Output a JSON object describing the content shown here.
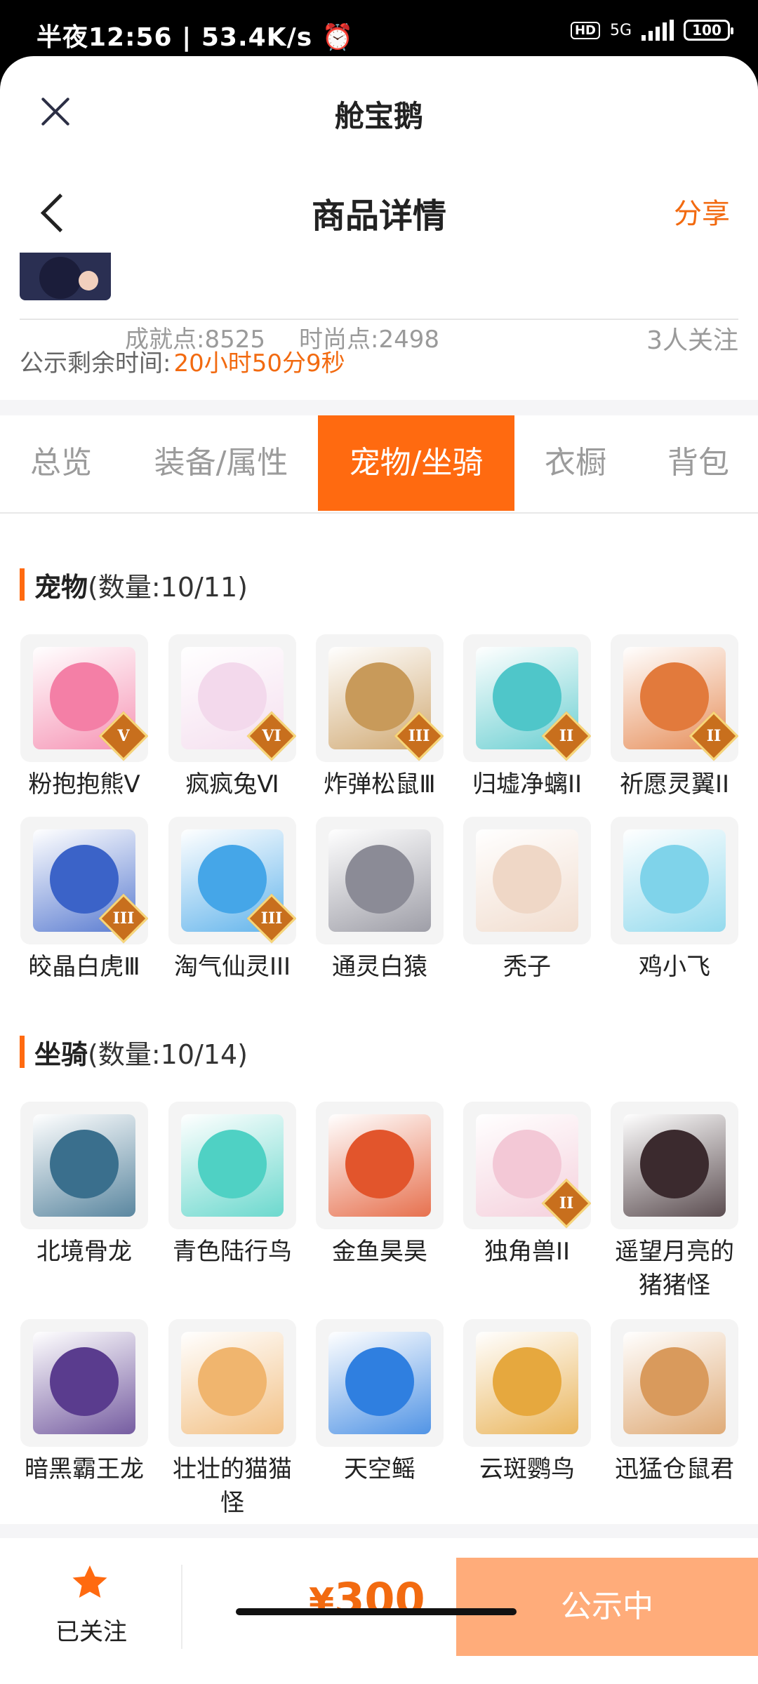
{
  "status_bar": {
    "time": "半夜12:56",
    "separator": "|",
    "speed": "53.4K/s",
    "hd": "HD",
    "network": "5G",
    "battery": "100"
  },
  "mini_app": {
    "title": "舱宝鹅"
  },
  "nav": {
    "title": "商品详情",
    "share": "分享"
  },
  "profile": {
    "achievement": "成就点:8525",
    "fashion": "时尚点:2498",
    "followers": "3人关注"
  },
  "publicity": {
    "label": "公示剩余时间:",
    "remaining": "20小时50分9秒"
  },
  "tabs": [
    {
      "label": "总览"
    },
    {
      "label": "装备/属性"
    },
    {
      "label": "宠物/坐骑",
      "active": true
    },
    {
      "label": "衣橱"
    },
    {
      "label": "背包"
    }
  ],
  "pets": {
    "title": "宠物",
    "count": "(数量:10/11)",
    "items": [
      {
        "name": "粉抱抱熊Ⅴ",
        "badge": "V",
        "color": "#f47fa6"
      },
      {
        "name": "疯疯兔Ⅵ",
        "badge": "VI",
        "color": "#f3d9ec"
      },
      {
        "name": "炸弹松鼠Ⅲ",
        "badge": "III",
        "color": "#c89a5a"
      },
      {
        "name": "归墟净螭II",
        "badge": "II",
        "color": "#4fc6c9"
      },
      {
        "name": "祈愿灵翼II",
        "badge": "II",
        "color": "#e27a3c"
      },
      {
        "name": "皎晶白虎Ⅲ",
        "badge": "III",
        "color": "#3b63c8"
      },
      {
        "name": "淘气仙灵III",
        "badge": "III",
        "color": "#45a6e8"
      },
      {
        "name": "通灵白猿",
        "badge": "",
        "color": "#8b8b96"
      },
      {
        "name": "秃子",
        "badge": "",
        "color": "#efd7c6"
      },
      {
        "name": "鸡小飞",
        "badge": "",
        "color": "#7fd3ea"
      }
    ]
  },
  "mounts": {
    "title": "坐骑",
    "count": "(数量:10/14)",
    "items": [
      {
        "name": "北境骨龙",
        "badge": "",
        "color": "#3a6f8d"
      },
      {
        "name": "青色陆行鸟",
        "badge": "",
        "color": "#4fd1c4"
      },
      {
        "name": "金鱼昊昊",
        "badge": "",
        "color": "#e2552c"
      },
      {
        "name": "独角兽II",
        "badge": "II",
        "color": "#f3c8d6"
      },
      {
        "name": "遥望月亮的猪猪怪",
        "badge": "",
        "color": "#3b2a2e"
      },
      {
        "name": "暗黑霸王龙",
        "badge": "",
        "color": "#5a3c8e"
      },
      {
        "name": "壮壮的猫猫怪",
        "badge": "",
        "color": "#f0b56e"
      },
      {
        "name": "天空鳐",
        "badge": "",
        "color": "#2f7fe0"
      },
      {
        "name": "云斑鹦鸟",
        "badge": "",
        "color": "#e6a83e"
      },
      {
        "name": "迅猛仓鼠君",
        "badge": "",
        "color": "#d99a5c"
      }
    ]
  },
  "bottom": {
    "follow_label": "已关注",
    "currency": "¥",
    "price": "300",
    "status": "公示中"
  },
  "colors": {
    "accent": "#ff6a10",
    "accent_soft": "#ffac7a"
  }
}
